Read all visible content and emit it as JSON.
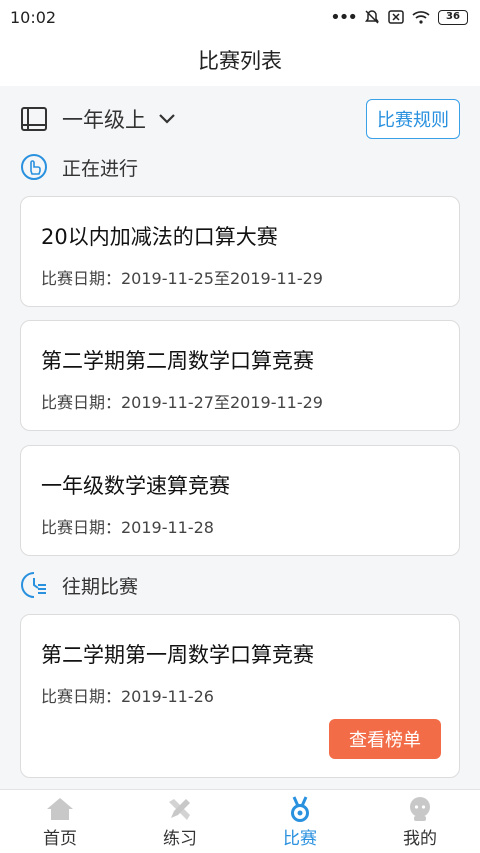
{
  "status_bar": {
    "time": "10:02",
    "battery": "36"
  },
  "header": {
    "title": "比赛列表"
  },
  "grade_selector": {
    "label": "一年级上"
  },
  "rules_button": {
    "label": "比赛规则"
  },
  "sections": {
    "ongoing": {
      "label": "正在进行",
      "items": [
        {
          "title": "20以内加减法的口算大赛",
          "date": "比赛日期：2019-11-25至2019-11-29"
        },
        {
          "title": "第二学期第二周数学口算竞赛",
          "date": "比赛日期：2019-11-27至2019-11-29"
        },
        {
          "title": "一年级数学速算竞赛",
          "date": "比赛日期：2019-11-28"
        }
      ]
    },
    "past": {
      "label": "往期比赛",
      "items": [
        {
          "title": "第二学期第一周数学口算竞赛",
          "date": "比赛日期：2019-11-26",
          "button": "查看榜单"
        }
      ]
    }
  },
  "tabbar": {
    "items": [
      {
        "label": "首页",
        "icon": "home-icon"
      },
      {
        "label": "练习",
        "icon": "practice-icon"
      },
      {
        "label": "比赛",
        "icon": "medal-icon",
        "active": true
      },
      {
        "label": "我的",
        "icon": "profile-icon"
      }
    ],
    "active_color": "#2a91df",
    "inactive_color": "#c8c8c8"
  },
  "colors": {
    "accent": "#2a91df",
    "rank_button": "#f26d47"
  }
}
